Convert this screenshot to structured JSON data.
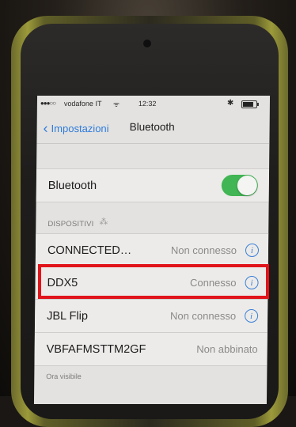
{
  "status_bar": {
    "signal": "●●●○○",
    "carrier": "vodafone IT",
    "wifi": "ᯤ",
    "time": "12:32",
    "bluetooth": "✱"
  },
  "nav": {
    "back_label": "Impostazioni",
    "title": "Bluetooth"
  },
  "bluetooth_toggle": {
    "label": "Bluetooth",
    "state": "on",
    "color": "#42b554"
  },
  "devices_section": {
    "header": "DISPOSITIVI",
    "devices": [
      {
        "name": "CONNECTED…",
        "status": "Non connesso",
        "info": "i"
      },
      {
        "name": "DDX5",
        "status": "Connesso",
        "info": "i"
      },
      {
        "name": "JBL Flip",
        "status": "Non connesso",
        "info": "i"
      },
      {
        "name": "VBFAFMSTTM2GF",
        "status": "Non abbinato"
      }
    ]
  },
  "footer_note": "Ora visibile",
  "colors": {
    "accent": "#2f7bdc",
    "highlight": "#e1141b"
  }
}
